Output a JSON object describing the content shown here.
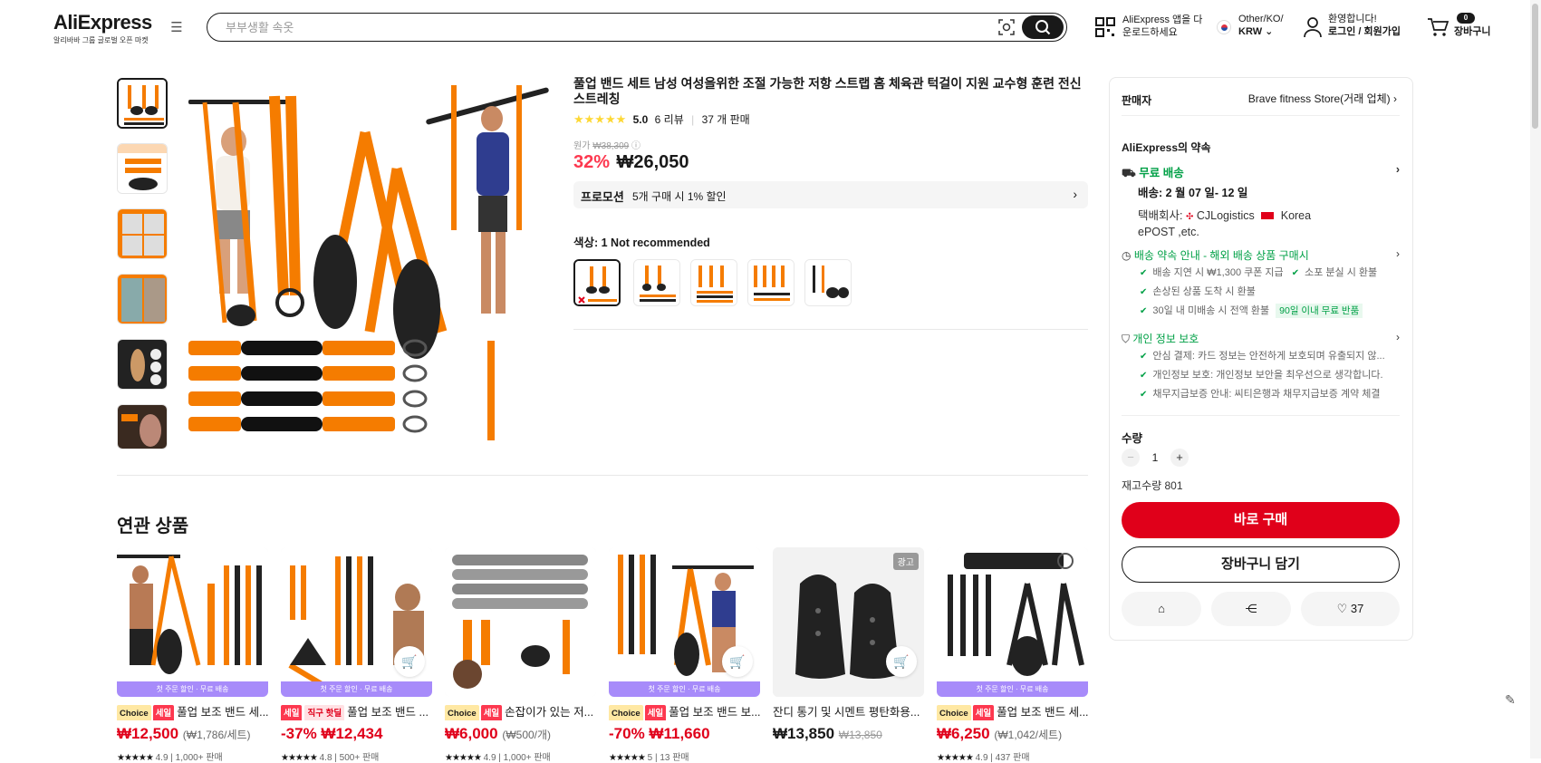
{
  "header": {
    "logo": "AliExpress",
    "logo_sub": "알리바바 그룹 글로벌 오픈 마켓",
    "search_placeholder": "부부생활 속옷",
    "app_line1": "AliExpress 앱을 다",
    "app_line2": "운로드하세요",
    "locale_line1": "Other/KO/",
    "currency": "KRW",
    "welcome": "환영합니다!",
    "login": "로그인 / 회원가입",
    "cart_count": "0",
    "cart_label": "장바구니"
  },
  "product": {
    "title": "풀업 밴드 세트 남성 여성을위한 조절 가능한 저항 스트랩 홈 체육관 턱걸이 지원 교수형 훈련 전신 스트레칭",
    "rating": "5.0",
    "reviews": "6 리뷰",
    "sold": "37 개 판매",
    "orig_label": "원가",
    "orig_price": "₩38,309",
    "discount": "32%",
    "price": "₩26,050",
    "promo_label": "프로모션",
    "promo_text": "5개 구매 시 1% 할인",
    "color_label": "색상: 1 Not recommended"
  },
  "sidebar": {
    "seller_label": "판매자",
    "seller_name": "Brave fitness Store(거래 업체)",
    "promise_title": "AliExpress의 약속",
    "free_ship": "무료 배송",
    "delivery": "배송: 2 월 07 일- 12 일",
    "courier_label": "택배회사:",
    "courier1": "CJLogistics",
    "courier2": "Korea",
    "courier3": "ePOST ,etc.",
    "guide_title": "배송 약속 안내 - 해외 배송 상품 구매시",
    "guide1": "배송 지연 시 ₩1,300 쿠폰 지급",
    "guide2": "소포 분실 시 환불",
    "guide3": "손상된 상품 도착 시 환불",
    "guide4": "30일 내 미배송 시 전액 환불",
    "guide_badge": "90일 이내 무료 반품",
    "privacy_title": "개인 정보 보호",
    "privacy1": "안심 결제: 카드 정보는 안전하게 보호되며 유출되지 않...",
    "privacy2": "개인정보 보호: 개인정보 보안을 최우선으로 생각합니다.",
    "privacy3": "채무지급보증 안내: 씨티은행과 채무지급보증 계약 체결",
    "qty_label": "수량",
    "qty": "1",
    "stock": "재고수량 801",
    "buy_now": "바로 구매",
    "add_cart": "장바구니 담기",
    "wish_count": "37"
  },
  "related": {
    "heading": "연관 상품",
    "banner": "첫 주문 할인 · 무료 배송",
    "ad_label": "광고",
    "items": [
      {
        "badge_choice": "Choice",
        "badge_sale": "세일",
        "title": "풀업 보조 밴드 세...",
        "price": "₩12,500",
        "unit": "(₩1,786/세트)",
        "rating": "4.9",
        "sold": "1,000+ 판매"
      },
      {
        "badge_sale": "세일",
        "badge_direct": "직구 핫딜",
        "title": "풀업 보조 밴드 ...",
        "discount": "-37%",
        "price": "₩12,434",
        "rating": "4.8",
        "sold": "500+ 판매"
      },
      {
        "badge_choice": "Choice",
        "badge_sale": "세일",
        "title": "손잡이가 있는 저...",
        "price": "₩6,000",
        "unit": "(₩500/개)",
        "rating": "4.9",
        "sold": "1,000+ 판매"
      },
      {
        "badge_choice": "Choice",
        "badge_sale": "세일",
        "title": "풀업 보조 밴드 보...",
        "discount": "-70%",
        "price": "₩11,660",
        "rating": "5",
        "sold": "13 판매"
      },
      {
        "title": "잔디 통기 및 시멘트 평탄화용...",
        "price": "₩13,850",
        "orig": "₩13,850"
      },
      {
        "badge_choice": "Choice",
        "badge_sale": "세일",
        "title": "풀업 보조 밴드 세...",
        "price": "₩6,250",
        "unit": "(₩1,042/세트)",
        "rating": "4.9",
        "sold": "437 판매"
      }
    ]
  },
  "colors": {
    "brand_red": "#e0001a",
    "green": "#00a046",
    "orange": "#f57c00"
  }
}
